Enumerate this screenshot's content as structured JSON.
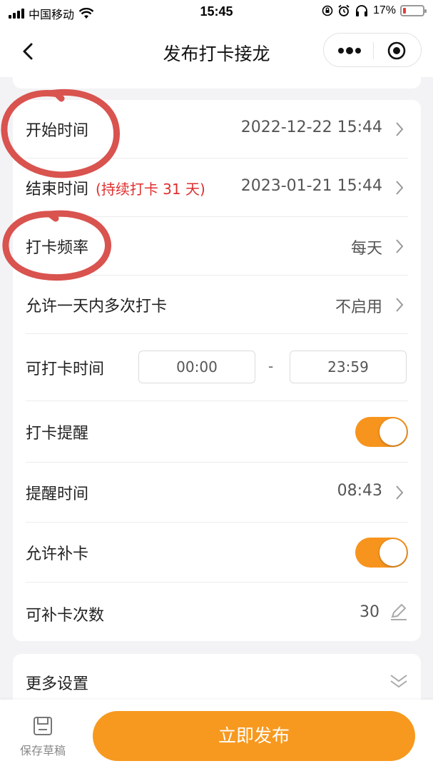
{
  "status_bar": {
    "carrier": "中国移动",
    "time": "15:45",
    "battery_percent": "17%",
    "battery_level": 0.17,
    "icons": [
      "signal-icon",
      "wifi-icon",
      "lock-rotation-icon",
      "alarm-icon",
      "headphones-icon",
      "battery-icon"
    ]
  },
  "nav": {
    "title": "发布打卡接龙",
    "back_icon": "chevron-left-icon",
    "menu_icon": "more-dots-icon",
    "close_icon": "target-circle-icon"
  },
  "settings": {
    "start_time": {
      "label": "开始时间",
      "value": "2022-12-22 15:44"
    },
    "end_time": {
      "label": "结束时间",
      "note": "(持续打卡 31 天)",
      "value": "2023-01-21 15:44"
    },
    "frequency": {
      "label": "打卡频率",
      "value": "每天"
    },
    "multiple_per_day": {
      "label": "允许一天内多次打卡",
      "value": "不启用"
    },
    "checkin_window": {
      "label": "可打卡时间",
      "from": "00:00",
      "separator": "-",
      "to": "23:59"
    },
    "reminder": {
      "label": "打卡提醒",
      "enabled": true
    },
    "reminder_time": {
      "label": "提醒时间",
      "value": "08:43"
    },
    "makeup": {
      "label": "允许补卡",
      "enabled": true
    },
    "makeup_count": {
      "label": "可补卡次数",
      "value": "30",
      "icon": "edit-pencil-icon"
    }
  },
  "more": {
    "label": "更多设置",
    "icon": "double-chevron-down-icon"
  },
  "bottom": {
    "draft_label": "保存草稿",
    "draft_icon": "save-floppy-icon",
    "publish_label": "立即发布"
  },
  "colors": {
    "accent": "#f7991e",
    "note_red": "#e02e2e",
    "annotation": "#d9534f"
  }
}
